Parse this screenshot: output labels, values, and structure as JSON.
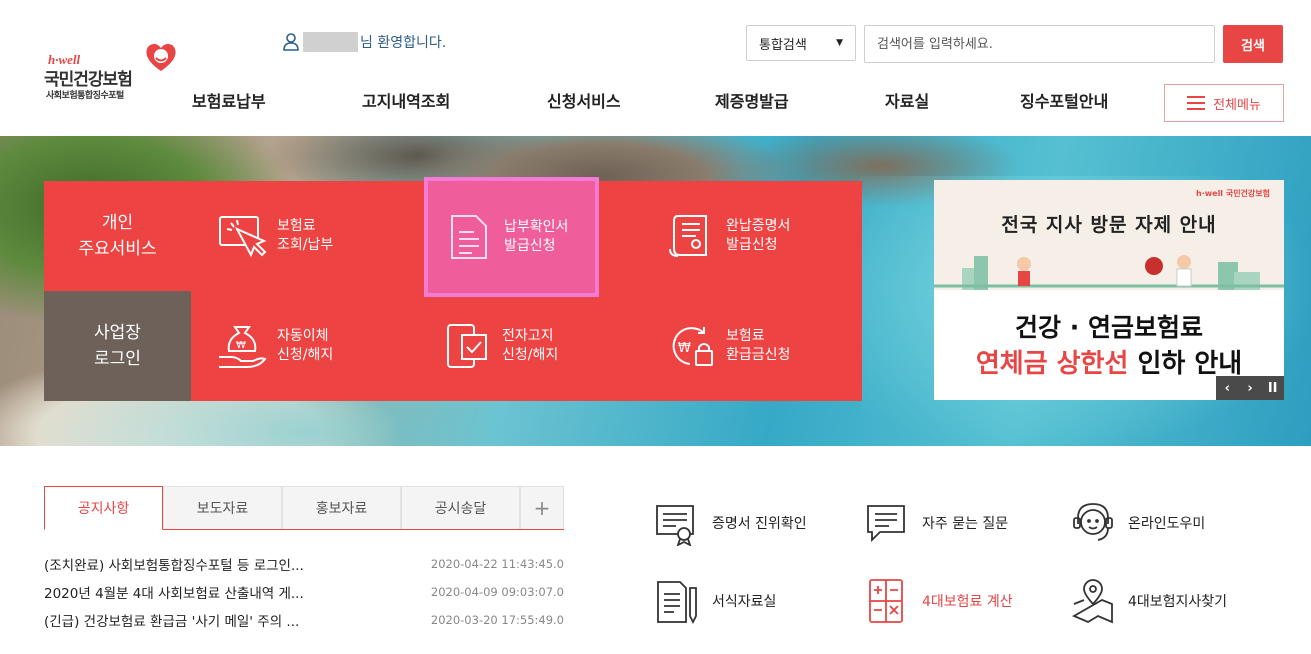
{
  "header": {
    "logo": {
      "hwell": "h·well",
      "brand": "국민건강보험",
      "sub": "사회보험통합징수포털"
    },
    "welcome": {
      "text": "님 환영합니다."
    },
    "search": {
      "scope": "통합검색",
      "placeholder": "검색어를 입력하세요.",
      "button": "검색"
    },
    "gnb": [
      "보험료납부",
      "고지내역조회",
      "신청서비스",
      "제증명발급",
      "자료실",
      "징수포털안내"
    ],
    "all_menu": "전체메뉴"
  },
  "services": {
    "tab_personal": "개인\n주요서비스",
    "tab_business": "사업장\n로그인",
    "items": [
      {
        "line1": "보험료",
        "line2": "조회/납부",
        "icon": "cursor-click-icon"
      },
      {
        "line1": "납부확인서",
        "line2": "발급신청",
        "icon": "document-icon"
      },
      {
        "line1": "완납증명서",
        "line2": "발급신청",
        "icon": "scroll-certificate-icon"
      },
      {
        "line1": "자동이체",
        "line2": "신청/해지",
        "icon": "money-bag-hand-icon"
      },
      {
        "line1": "전자고지",
        "line2": "신청/해지",
        "icon": "phone-check-icon"
      },
      {
        "line1": "보험료",
        "line2": "환급금신청",
        "icon": "refund-lock-icon"
      }
    ]
  },
  "banner": {
    "brand": "h·well 국민건강보험",
    "title1": "전국 지사 방문 자제 안내",
    "title2": "건강 · 연금보험료",
    "title3_red": "연체금 상한선",
    "title3_rest": " 인하 안내",
    "controls": [
      "‹",
      "›",
      "II"
    ]
  },
  "notices": {
    "tabs": [
      "공지사항",
      "보도자료",
      "홍보자료",
      "공시송달",
      "+"
    ],
    "rows": [
      {
        "title": "(조치완료) 사회보험통합징수포털 등 로그인...",
        "date": "2020-04-22 11:43:45.0"
      },
      {
        "title": "2020년 4월분 4대 사회보험료 산출내역 게...",
        "date": "2020-04-09 09:03:07.0"
      },
      {
        "title": "(긴급) 건강보험료 환급금 '사기 메일' 주의 ...",
        "date": "2020-03-20 17:55:49.0"
      }
    ]
  },
  "quick_links": [
    {
      "label": "증명서 진위확인",
      "icon": "certificate-verify-icon"
    },
    {
      "label": "자주 묻는 질문",
      "icon": "chat-bubble-icon"
    },
    {
      "label": "온라인도우미",
      "icon": "headset-agent-icon"
    },
    {
      "label": "서식자료실",
      "icon": "form-document-icon"
    },
    {
      "label": "4대보험료 계산",
      "icon": "calculator-icon"
    },
    {
      "label": "4대보험지사찾기",
      "icon": "map-pin-icon"
    }
  ],
  "colors": {
    "accent": "#e84545",
    "business_tab": "#6d615a",
    "selected": "#ef5e9a"
  }
}
